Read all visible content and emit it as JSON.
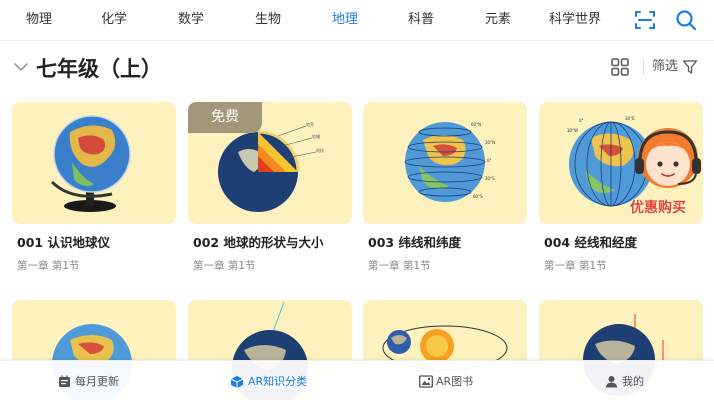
{
  "tabs": [
    {
      "label": "物理"
    },
    {
      "label": "化学"
    },
    {
      "label": "数学"
    },
    {
      "label": "生物"
    },
    {
      "label": "地理"
    },
    {
      "label": "科普"
    },
    {
      "label": "元素"
    },
    {
      "label": "科学世界"
    }
  ],
  "active_tab": "地理",
  "header": {
    "grade_title": "七年级（上）",
    "filter_label": "筛选"
  },
  "cards": [
    {
      "title": "001 认识地球仪",
      "subtitle": "第一章 第1节",
      "badge": ""
    },
    {
      "title": "002 地球的形状与大小",
      "subtitle": "第一章 第1节",
      "badge": "免费"
    },
    {
      "title": "003 纬线和纬度",
      "subtitle": "第一章 第1节",
      "badge": ""
    },
    {
      "title": "004 经线和经度",
      "subtitle": "第一章 第1节",
      "badge": ""
    }
  ],
  "promo": {
    "label": "优惠购买"
  },
  "bottom_nav": [
    {
      "label": "每月更新",
      "icon": "calendar-icon"
    },
    {
      "label": "AR知识分类",
      "icon": "cube-icon"
    },
    {
      "label": "AR图书",
      "icon": "picture-book-icon"
    },
    {
      "label": "我的",
      "icon": "user-icon"
    }
  ],
  "colors": {
    "accent": "#1a7fe0",
    "card_bg": "#fdf1bd",
    "badge_bg": "#a2977a",
    "promo_text": "#e0472b"
  }
}
